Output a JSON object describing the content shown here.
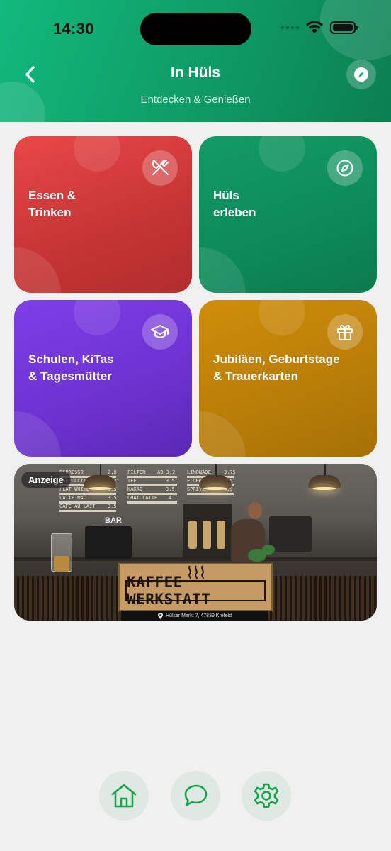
{
  "status_bar": {
    "time": "14:30"
  },
  "header": {
    "title": "In Hüls",
    "subtitle": "Entdecken & Genießen",
    "back_icon": "chevron-left-icon",
    "action_icon": "compass-icon"
  },
  "tiles": [
    {
      "label": "Essen &\nTrinken",
      "icon": "fork-knife-icon",
      "color": "#d93d3d"
    },
    {
      "label": "Hüls\nerleben",
      "icon": "compass-icon",
      "color": "#0f8c5c"
    },
    {
      "label": "Schulen, KiTas\n& Tagesmütter",
      "icon": "graduation-cap-icon",
      "color": "#6d33d0"
    },
    {
      "label": "Jubiläen, Geburtstage\n& Trauerkarten",
      "icon": "gift-icon",
      "color": "#bf8308"
    }
  ],
  "ad": {
    "badge": "Anzeige",
    "sign_text": "KAFFEE WERKSTATT",
    "address": "Hülser Markt 7, 47839 Krefeld",
    "bar_label": "BAR",
    "menu_left": [
      "ESPRESSO",
      "CAPPUCCINO",
      "FLAT WHITE",
      "LATTE MAC.",
      "CAFE AU LAIT"
    ],
    "menu_left_prices": [
      "2.8",
      "3.2",
      "3.5",
      "3.5",
      "3.5"
    ],
    "menu_mid": [
      "FILTER",
      "TEE",
      "KAKAO",
      "CHAI LATTE"
    ],
    "menu_mid_prices": [
      "AB 3.2",
      "3.5",
      "3.5",
      "4"
    ],
    "menu_right": [
      "LIMONADE",
      "ELDERFLOWER",
      "SPRITZ"
    ],
    "menu_right_prices": [
      "3.75",
      "4.5",
      "4.9"
    ]
  },
  "bottom_nav": [
    {
      "icon": "home-icon",
      "accent": "#16a34a"
    },
    {
      "icon": "chat-icon",
      "accent": "#16a34a"
    },
    {
      "icon": "settings-icon",
      "accent": "#16a34a"
    }
  ]
}
